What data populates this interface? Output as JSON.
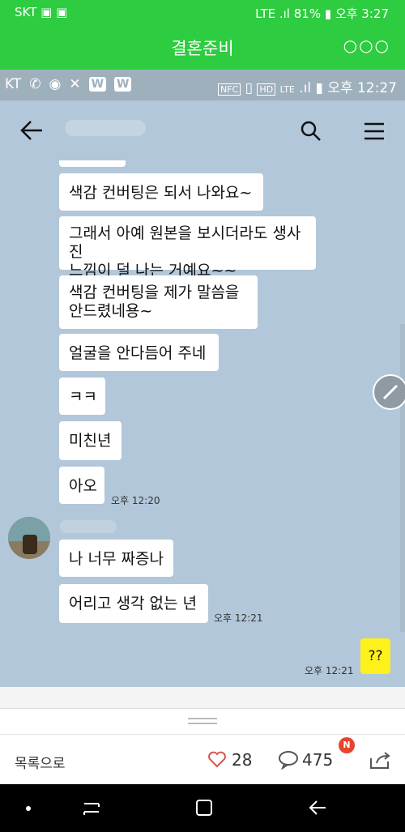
{
  "outer_status": {
    "carrier": "SKT",
    "signal": "LTE",
    "battery": "81%",
    "time": "오후 3:27"
  },
  "app_header": {
    "title": "결혼준비",
    "more": "○○○"
  },
  "inner_status": {
    "carrier": "KT",
    "w1": "W",
    "w2": "W",
    "nfc": "NFC",
    "hd": "HD",
    "lte": "LTE",
    "time": "오후 12:27"
  },
  "chat": {
    "messages": [
      {
        "text": "색감 컨버팅은 되서 나와요~"
      },
      {
        "text": "그래서 아예 원본을 보시더라도 생사진\n느낌이 덜 나는 거예요~~"
      },
      {
        "text": "색감 컨버팅을 제가 말씀을\n안드렸네용~"
      },
      {
        "text": "얼굴을 안다듬어 주네"
      },
      {
        "text": "ㅋㅋ"
      },
      {
        "text": "미친년"
      },
      {
        "text": "아오"
      },
      {
        "text": "나 너무 짜증나"
      },
      {
        "text": "어리고 생각 없는 년"
      },
      {
        "text": "??"
      }
    ],
    "timestamps": [
      "오후 12:20",
      "오후 12:21",
      "오후 12:21"
    ]
  },
  "bottom": {
    "list_label": "목록으로",
    "likes": "28",
    "comments": "475",
    "badge": "N"
  },
  "colors": {
    "green": "#2ecc40",
    "chat_bg": "#b2c7d9",
    "my_bubble": "#fef01b"
  }
}
